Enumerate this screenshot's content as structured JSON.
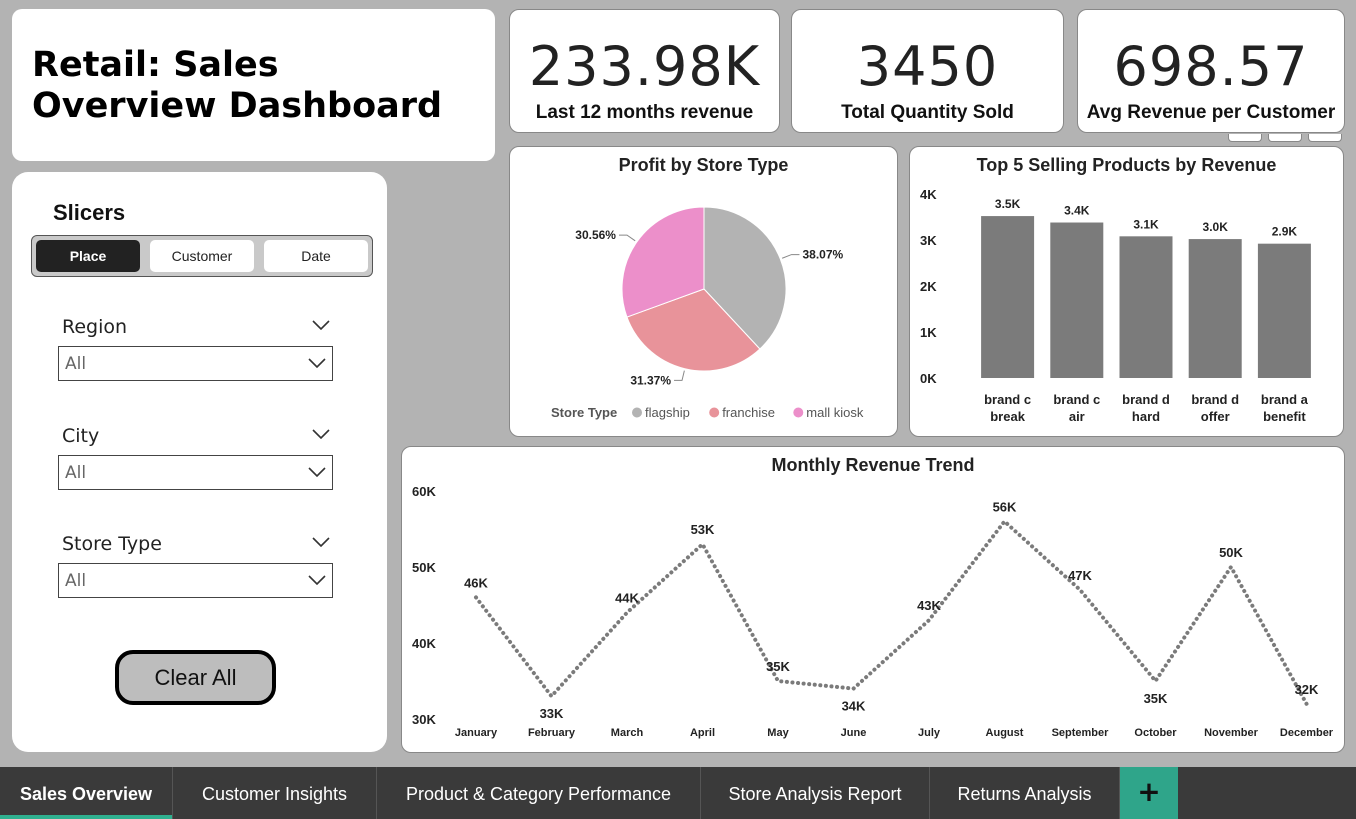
{
  "title": "Retail: Sales\nOverview Dashboard",
  "kpis": [
    {
      "value": "233.98K",
      "label": "Last 12 months revenue"
    },
    {
      "value": "3450",
      "label": "Total Quantity Sold"
    },
    {
      "value": "698.57",
      "label": "Avg Revenue per Customer"
    }
  ],
  "slicers": {
    "heading": "Slicers",
    "segments": [
      "Place",
      "Customer",
      "Date"
    ],
    "active_segment": "Place",
    "filters": [
      {
        "label": "Region",
        "value": "All"
      },
      {
        "label": "City",
        "value": "All"
      },
      {
        "label": "Store Type",
        "value": "All"
      }
    ],
    "clear_label": "Clear All"
  },
  "tabs": [
    {
      "label": "Sales Overview",
      "active": true
    },
    {
      "label": "Customer Insights",
      "active": false
    },
    {
      "label": "Product & Category Performance",
      "active": false
    },
    {
      "label": "Store Analysis Report",
      "active": false
    },
    {
      "label": "Returns Analysis",
      "active": false
    }
  ],
  "add_tab_label": "+",
  "colors": {
    "flagship": "#b3b3b3",
    "franchise": "#e8939a",
    "mall_kiosk": "#ec8fca",
    "bar": "#7b7b7b",
    "line": "#7b7b7b",
    "accent": "#2fb08f"
  },
  "chart_data": [
    {
      "type": "pie",
      "title": "Profit by Store Type",
      "legend_title": "Store Type",
      "legend_position": "bottom",
      "slices": [
        {
          "name": "flagship",
          "value": 38.07,
          "label": "38.07%"
        },
        {
          "name": "franchise",
          "value": 31.37,
          "label": "31.37%"
        },
        {
          "name": "mall kiosk",
          "value": 30.56,
          "label": "30.56%"
        }
      ]
    },
    {
      "type": "bar",
      "title": "Top 5 Selling Products by Revenue",
      "categories": [
        "brand c\nbreak",
        "brand c\nair",
        "brand d\nhard",
        "brand d\noffer",
        "brand a\nbenefit"
      ],
      "values": [
        3520,
        3380,
        3080,
        3020,
        2920
      ],
      "data_labels": [
        "3.5K",
        "3.4K",
        "3.1K",
        "3.0K",
        "2.9K"
      ],
      "yticks": [
        "0K",
        "1K",
        "2K",
        "3K",
        "4K"
      ],
      "ylim": [
        0,
        4000
      ]
    },
    {
      "type": "line",
      "title": "Monthly Revenue Trend",
      "categories": [
        "January",
        "February",
        "March",
        "April",
        "May",
        "June",
        "July",
        "August",
        "September",
        "October",
        "November",
        "December"
      ],
      "values": [
        46000,
        33000,
        44000,
        53000,
        35000,
        34000,
        43000,
        56000,
        47000,
        35000,
        50000,
        32000
      ],
      "data_labels": [
        "46K",
        "33K",
        "44K",
        "53K",
        "35K",
        "34K",
        "43K",
        "56K",
        "47K",
        "35K",
        "50K",
        "32K"
      ],
      "yticks": [
        "30K",
        "40K",
        "50K",
        "60K"
      ],
      "ylim": [
        30000,
        60000
      ]
    }
  ]
}
